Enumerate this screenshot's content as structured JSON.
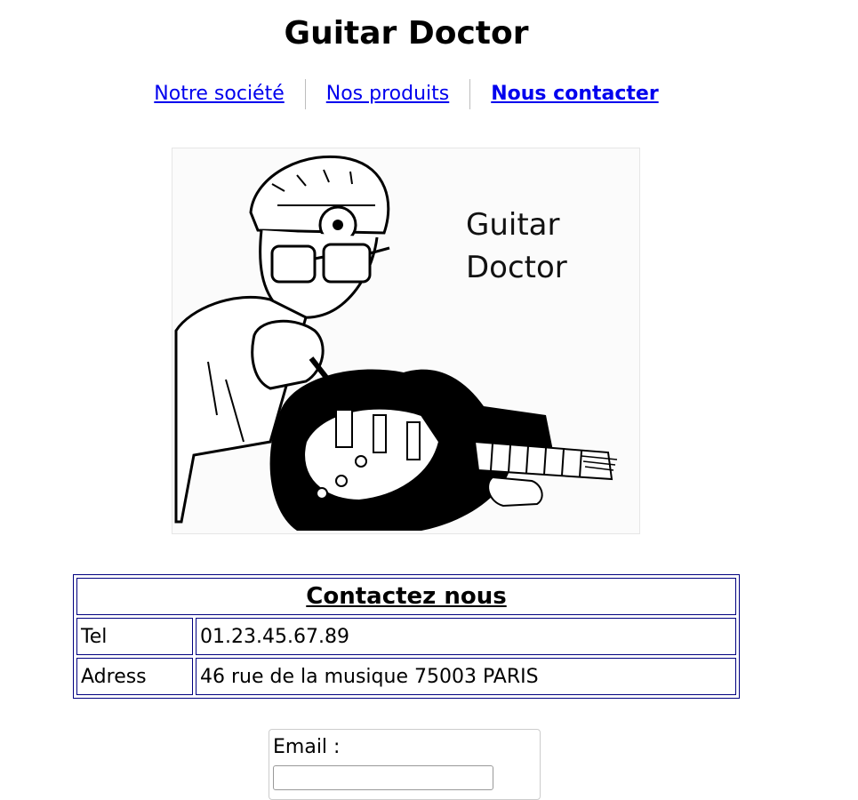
{
  "header": {
    "title": "Guitar Doctor"
  },
  "nav": {
    "items": [
      {
        "label": "Notre société",
        "active": false
      },
      {
        "label": "Nos produits",
        "active": false
      },
      {
        "label": "Nous contacter",
        "active": true
      }
    ]
  },
  "logo": {
    "text_line1": "Guitar",
    "text_line2": "Doctor"
  },
  "contact_table": {
    "caption": "Contactez nous",
    "rows": [
      {
        "key": "Tel",
        "value": "01.23.45.67.89"
      },
      {
        "key": "Adress",
        "value": "46 rue de la musique 75003 PARIS"
      }
    ]
  },
  "form": {
    "email_label": "Email :",
    "email_value": ""
  },
  "colors": {
    "link": "#0000ee",
    "table_border": "#000080"
  }
}
